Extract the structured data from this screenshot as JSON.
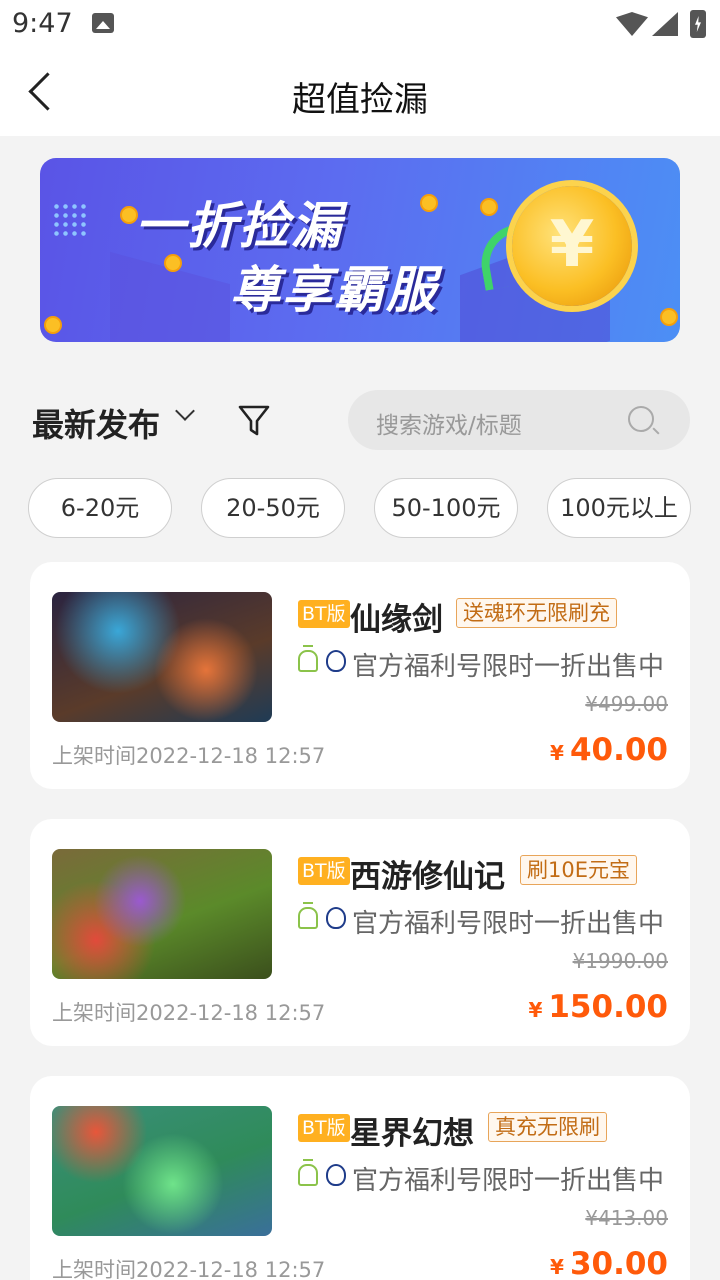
{
  "status_bar": {
    "time": "9:47"
  },
  "nav": {
    "title": "超值捡漏"
  },
  "banner": {
    "line1": "一折捡漏",
    "line2": "尊享霸服",
    "coin_symbol": "¥"
  },
  "filter": {
    "sort_label": "最新发布",
    "search_placeholder": "搜索游戏/标题"
  },
  "price_chips": [
    "6-20元",
    "20-50元",
    "50-100元",
    "100元以上"
  ],
  "listings": [
    {
      "bt_label": "BT版",
      "name": "仙缘剑",
      "tag": "送魂环无限刷充",
      "desc": "官方福利号限时一折出售中",
      "original_price": "¥499.00",
      "listed_time": "上架时间2022-12-18 12:57",
      "currency": "¥",
      "price": "40.00"
    },
    {
      "bt_label": "BT版",
      "name": "西游修仙记",
      "tag": "刷10E元宝",
      "desc": "官方福利号限时一折出售中",
      "original_price": "¥1990.00",
      "listed_time": "上架时间2022-12-18 12:57",
      "currency": "¥",
      "price": "150.00"
    },
    {
      "bt_label": "BT版",
      "name": "星界幻想",
      "tag": "真充无限刷",
      "desc": "官方福利号限时一折出售中",
      "original_price": "¥413.00",
      "listed_time": "上架时间2022-12-18 12:57",
      "currency": "¥",
      "price": "30.00"
    }
  ],
  "colors": {
    "accent": "#ff5a0a",
    "bt_badge": "#ffb020",
    "tag_border": "#e8a55a",
    "banner_start": "#5a54e6",
    "banner_end": "#4c8ff5"
  }
}
